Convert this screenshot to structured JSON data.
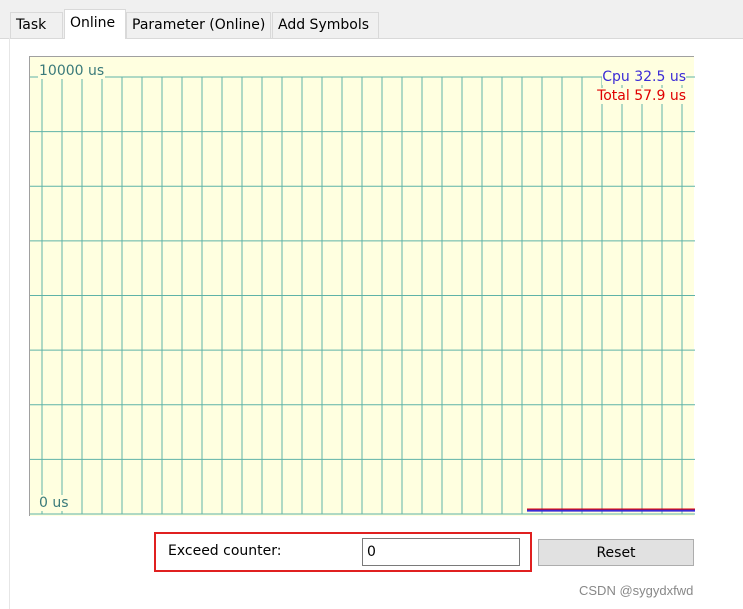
{
  "tabs": [
    {
      "label": "Task",
      "active": false
    },
    {
      "label": "Online",
      "active": true
    },
    {
      "label": "Parameter (Online)",
      "active": false
    },
    {
      "label": "Add Symbols",
      "active": false
    }
  ],
  "chart": {
    "y_max_label": "10000 us",
    "y_min_label": "0 us",
    "cpu_label": "Cpu 32.5 us",
    "total_label": "Total 57.9 us",
    "colors": {
      "background": "#ffffe0",
      "grid": "#5fb3a8",
      "cpu": "#3b2bd6",
      "total": "#e00000"
    }
  },
  "chart_data": {
    "type": "line",
    "ylim": [
      0,
      10000
    ],
    "grid": true,
    "series": [
      {
        "name": "Cpu",
        "value": 32.5
      },
      {
        "name": "Total",
        "value": 57.9
      }
    ]
  },
  "counter": {
    "label": "Exceed counter:",
    "value": "0"
  },
  "reset_label": "Reset",
  "watermark": "CSDN @sygydxfwd"
}
